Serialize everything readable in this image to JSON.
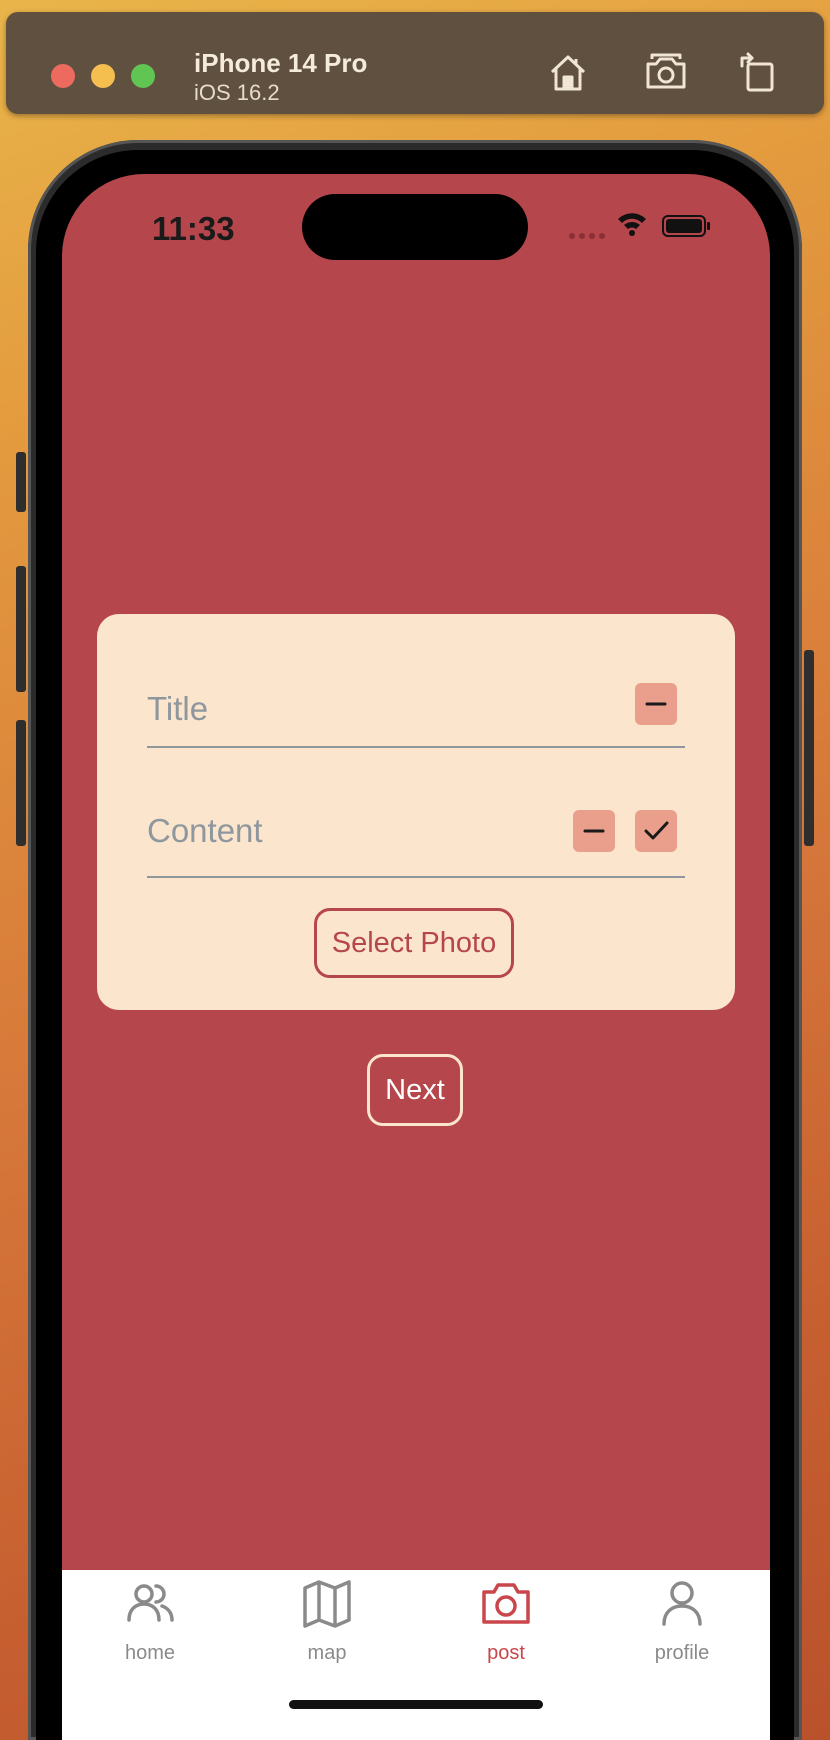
{
  "simulator": {
    "device_name": "iPhone 14 Pro",
    "os_version": "iOS 16.2",
    "buttons": [
      "home-icon",
      "screenshot-icon",
      "rotate-icon"
    ]
  },
  "status_bar": {
    "time": "11:33",
    "icons": [
      "signal-dots-icon",
      "wifi-icon",
      "battery-icon"
    ]
  },
  "form": {
    "title_placeholder": "Title",
    "content_placeholder": "Content",
    "select_photo_label": "Select Photo",
    "icons": [
      "minus-icon",
      "checkmark-icon"
    ]
  },
  "next_label": "Next",
  "tabbar": {
    "items": [
      {
        "label": "home",
        "icon": "people-icon",
        "active": false
      },
      {
        "label": "map",
        "icon": "map-icon",
        "active": false
      },
      {
        "label": "post",
        "icon": "camera-icon",
        "active": true
      },
      {
        "label": "profile",
        "icon": "person-icon",
        "active": false
      }
    ]
  },
  "colors": {
    "screen_background": "#b5464b",
    "card_background": "#fbe5cc",
    "mini_button": "#ea9f8c",
    "active_tab": "#c9474a",
    "inactive_tab": "#8a8a8a"
  }
}
